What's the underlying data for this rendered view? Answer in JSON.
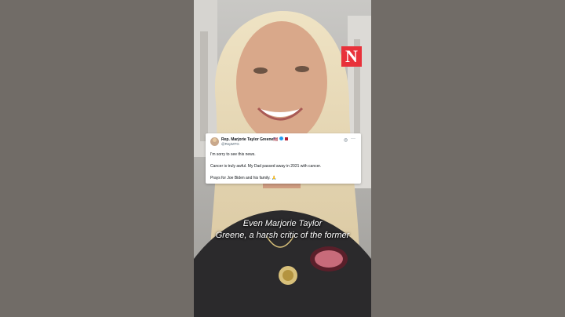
{
  "logo": {
    "letter": "N",
    "color": "#e8313a"
  },
  "tweet": {
    "author_name": "Rep. Marjorie Taylor Greene🇺🇸",
    "handle": "@RepMTG",
    "icons": [
      "verified-badge-icon",
      "flag-badge-icon",
      "grok-icon",
      "more-icon"
    ],
    "lines": [
      "I'm sorry to see this news.",
      "Cancer is truly awful.  My Dad passed away in 2021 with cancer.",
      "Prays for Joe Biden and his family. 🙏"
    ]
  },
  "caption": {
    "line1": "Even Marjorie Taylor",
    "line2": "Greene, a harsh critic of the former"
  }
}
